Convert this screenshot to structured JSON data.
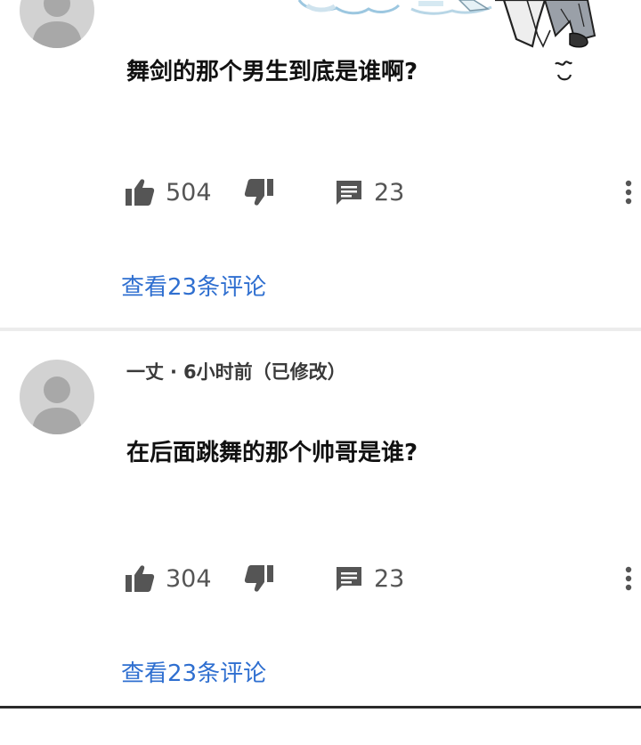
{
  "colors": {
    "link": "#2f6fd0",
    "avatar_bg": "#d2d2d2",
    "avatar_fg": "#a8a8a8",
    "icon": "#555555"
  },
  "comments": [
    {
      "text": "舞剑的那个男生到底是谁啊?",
      "likes": "504",
      "replies": "23",
      "view_replies": "查看23条评论"
    },
    {
      "author": "一丈",
      "time": "6小时前（已修改）",
      "text": "在后面跳舞的那个帅哥是谁?",
      "likes": "304",
      "replies": "23",
      "view_replies": "查看23条评论"
    }
  ],
  "icons": {
    "like": "thumb-up-icon",
    "dislike": "thumb-down-icon",
    "reply": "comment-icon",
    "more": "more-vertical-icon",
    "avatar": "default-avatar-icon",
    "sticker": "cartoon-character-sticker"
  }
}
